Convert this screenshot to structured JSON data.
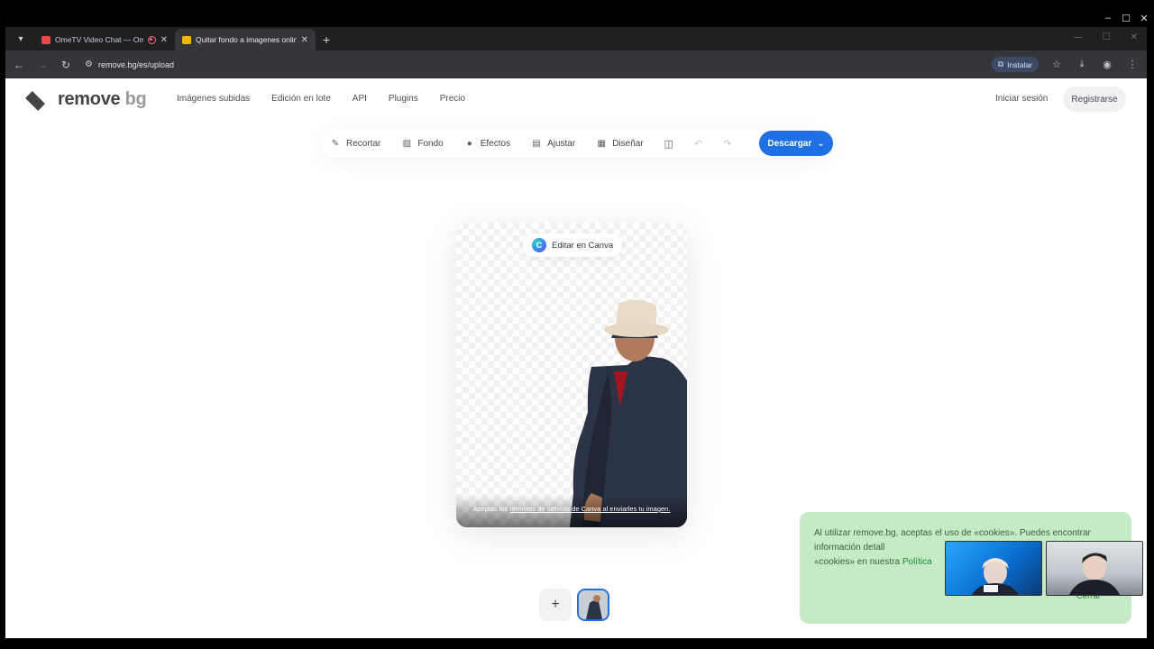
{
  "browser": {
    "tabs": [
      {
        "label": "OmeTV Video Chat — Ome",
        "favicon_color": "#e24b4b",
        "active": false
      },
      {
        "label": "Quitar fondo a imagenes onlin",
        "favicon_color": "#f2b705",
        "active": true
      }
    ],
    "url": "remove.bg/es/upload",
    "install_label": "Instalar"
  },
  "site": {
    "logo_main": "remove",
    "logo_accent": "bg",
    "nav": [
      "Imágenes subidas",
      "Edición en lote",
      "API",
      "Plugins",
      "Precio"
    ],
    "login": "Iniciar sesión",
    "register": "Registrarse"
  },
  "editor": {
    "tools": [
      {
        "label": "Recortar",
        "icon": "brush-icon"
      },
      {
        "label": "Fondo",
        "icon": "image-icon"
      },
      {
        "label": "Efectos",
        "icon": "effects-icon"
      },
      {
        "label": "Ajustar",
        "icon": "adjust-icon"
      },
      {
        "label": "Diseñar",
        "icon": "design-icon"
      }
    ],
    "download": "Descargar",
    "canva_button": "Editar en Canva",
    "canva_logo": "C",
    "caption_before": "Aceptas los ",
    "caption_link": "términos de servicio de Canva al enviarles tu imagen.",
    "add_image": "+"
  },
  "cookie": {
    "text": "Al utilizar remove.bg, aceptas el uso de «cookies». Puedes encontrar información detall",
    "text2": "«cookies» en nuestra ",
    "link": "Política",
    "close": "Cerrar",
    "bg_color": "#c6ebc4"
  },
  "colors": {
    "accent": "#1f6fe5"
  }
}
